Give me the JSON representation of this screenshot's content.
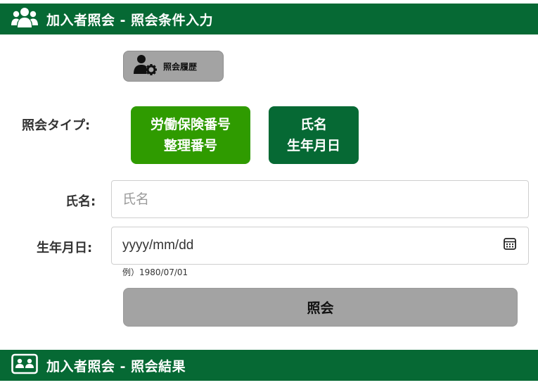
{
  "header": {
    "title": "加入者照会 - 照会条件入力",
    "icon": "users-icon"
  },
  "history_button": {
    "label": "照会履歴",
    "icon": "user-gear-icon"
  },
  "query_type": {
    "label": "照会タイプ:",
    "options": [
      {
        "line1": "労働保険番号",
        "line2": "整理番号",
        "color": "#2f9b00"
      },
      {
        "line1": "氏名",
        "line2": "生年月日",
        "color": "#066934"
      }
    ]
  },
  "name_field": {
    "label": "氏名:",
    "placeholder": "氏名"
  },
  "dob_field": {
    "label": "生年月日:",
    "value": "yyyy/mm/dd",
    "hint": "例）1980/07/01",
    "icon": "calendar-icon"
  },
  "submit_button": {
    "label": "照会"
  },
  "results_header": {
    "title": "加入者照会 - 照会結果",
    "icon": "id-card-icon"
  },
  "colors": {
    "brand_green": "#066934",
    "accent_green": "#2f9b00",
    "button_gray": "#a3a3a3"
  }
}
